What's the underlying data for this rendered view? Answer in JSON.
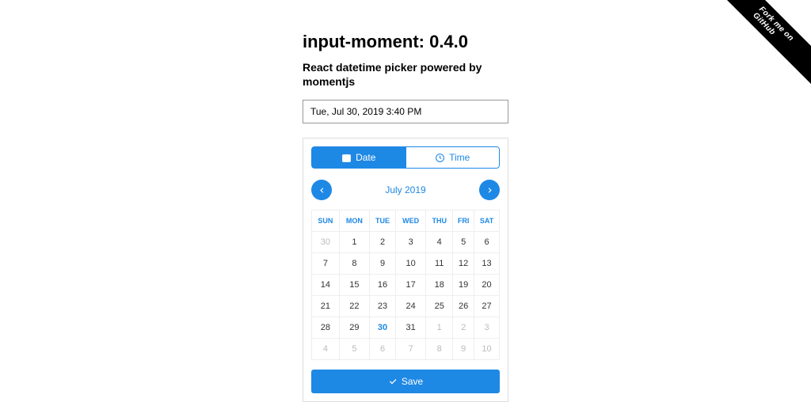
{
  "heading": "input-moment: 0.4.0",
  "subheading": "React datetime picker powered by momentjs",
  "input_value": "Tue, Jul 30, 2019 3:40 PM",
  "tabs": {
    "date": "Date",
    "time": "Time"
  },
  "month_label": "July 2019",
  "weekdays": [
    "SUN",
    "MON",
    "TUE",
    "WED",
    "THU",
    "FRI",
    "SAT"
  ],
  "calendar": {
    "selected": 30,
    "rows": [
      [
        {
          "d": 30,
          "o": true
        },
        {
          "d": 1
        },
        {
          "d": 2
        },
        {
          "d": 3
        },
        {
          "d": 4
        },
        {
          "d": 5
        },
        {
          "d": 6
        }
      ],
      [
        {
          "d": 7
        },
        {
          "d": 8
        },
        {
          "d": 9
        },
        {
          "d": 10
        },
        {
          "d": 11
        },
        {
          "d": 12
        },
        {
          "d": 13
        }
      ],
      [
        {
          "d": 14
        },
        {
          "d": 15
        },
        {
          "d": 16
        },
        {
          "d": 17
        },
        {
          "d": 18
        },
        {
          "d": 19
        },
        {
          "d": 20
        }
      ],
      [
        {
          "d": 21
        },
        {
          "d": 22
        },
        {
          "d": 23
        },
        {
          "d": 24
        },
        {
          "d": 25
        },
        {
          "d": 26
        },
        {
          "d": 27
        }
      ],
      [
        {
          "d": 28
        },
        {
          "d": 29
        },
        {
          "d": 30,
          "sel": true
        },
        {
          "d": 31
        },
        {
          "d": 1,
          "o": true
        },
        {
          "d": 2,
          "o": true
        },
        {
          "d": 3,
          "o": true
        }
      ],
      [
        {
          "d": 4,
          "o": true
        },
        {
          "d": 5,
          "o": true
        },
        {
          "d": 6,
          "o": true
        },
        {
          "d": 7,
          "o": true
        },
        {
          "d": 8,
          "o": true
        },
        {
          "d": 9,
          "o": true
        },
        {
          "d": 10,
          "o": true
        }
      ]
    ]
  },
  "save_label": "Save",
  "ribbon": "Fork me on GitHub"
}
